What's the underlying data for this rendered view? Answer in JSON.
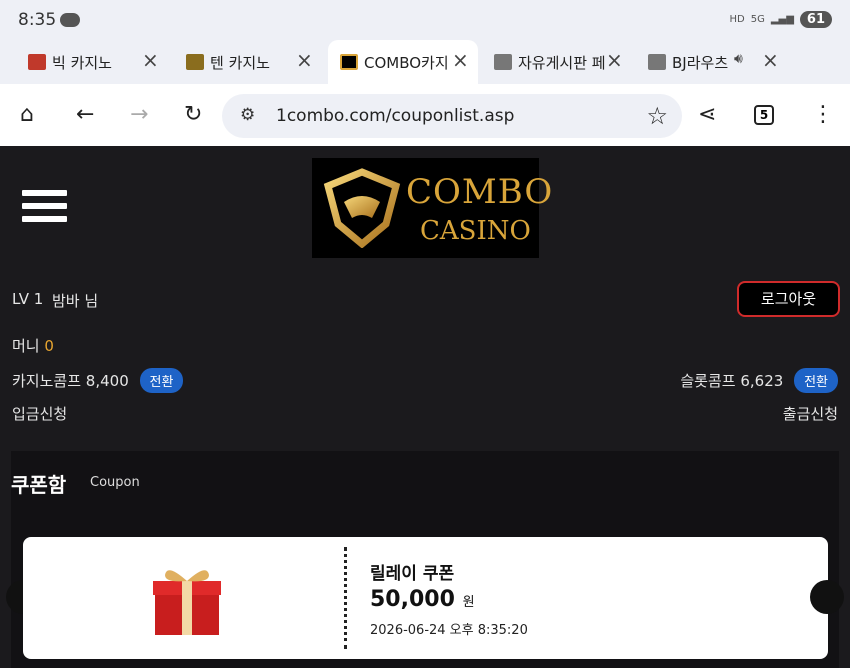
{
  "status": {
    "time": "8:35",
    "hd": "HD",
    "net": "5G",
    "battery": "61"
  },
  "tabs": [
    {
      "title": "빅 카지노",
      "favicon_color": "#c0392b"
    },
    {
      "title": "텐 카지노",
      "favicon_color": "#8a6d1e"
    },
    {
      "title": "COMBO카지",
      "favicon_color": "#d9a53a"
    },
    {
      "title": "자유게시판 페",
      "favicon_color": "#777777"
    },
    {
      "title": "BJ라우츠",
      "favicon_color": "#777777"
    }
  ],
  "browser": {
    "url": "1combo.com/couponlist.asp",
    "tab_count": "5"
  },
  "header": {
    "logo_line1": "COMBO",
    "logo_line2": "CASINO"
  },
  "user": {
    "level": "LV 1",
    "nickname": "밤바 님",
    "logout_label": "로그아웃",
    "money_label": "머니",
    "money_value": "0",
    "casino_comp_label": "카지노콤프",
    "casino_comp_value": "8,400",
    "slot_comp_label": "슬롯콤프",
    "slot_comp_value": "6,623",
    "convert_label": "전환",
    "deposit_label": "입금신청",
    "withdraw_label": "출금신청"
  },
  "coupon": {
    "title": "쿠폰함",
    "subtitle": "Coupon",
    "items": [
      {
        "name": "릴레이 쿠폰",
        "amount": "50,000",
        "unit": "원",
        "date": "2026-06-24 오후 8:35:20"
      }
    ]
  }
}
